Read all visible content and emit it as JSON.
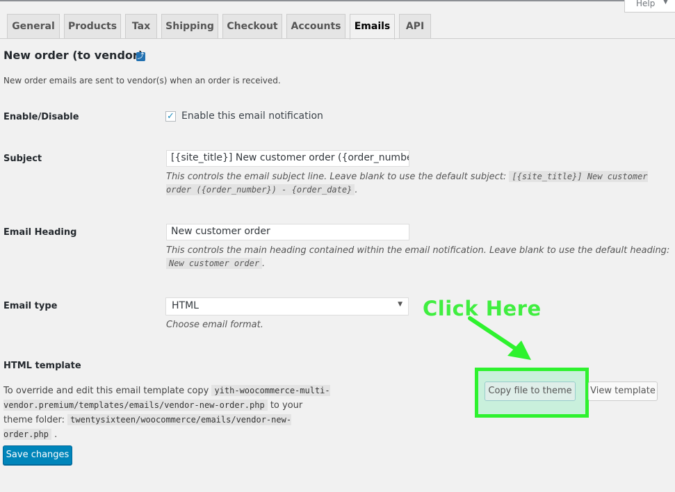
{
  "help": {
    "label": "Help"
  },
  "tabs": [
    {
      "label": "General"
    },
    {
      "label": "Products"
    },
    {
      "label": "Tax"
    },
    {
      "label": "Shipping"
    },
    {
      "label": "Checkout"
    },
    {
      "label": "Accounts"
    },
    {
      "label": "Emails",
      "active": true
    },
    {
      "label": "API"
    }
  ],
  "page": {
    "title": "New order (to vendor)",
    "intro": "New order emails are sent to vendor(s) when an order is received."
  },
  "enable": {
    "label": "Enable/Disable",
    "checkbox_label": "Enable this email notification",
    "checked": true
  },
  "subject": {
    "label": "Subject",
    "value": "[{site_title}] New customer order ({order_number}) - {",
    "desc_prefix": "This controls the email subject line. Leave blank to use the default subject:",
    "desc_code": "[{site_title}] New customer order ({order_number}) - {order_date}",
    "desc_suffix": "."
  },
  "heading": {
    "label": "Email Heading",
    "value": "New customer order",
    "desc_prefix": "This controls the main heading contained within the email notification. Leave blank to use the default heading:",
    "desc_code": "New customer order",
    "desc_suffix": "."
  },
  "email_type": {
    "label": "Email type",
    "selected": "HTML",
    "desc": "Choose email format."
  },
  "html_template": {
    "title": "HTML template",
    "prefix": "To override and edit this email template copy",
    "code1": "yith-woocommerce-multi-vendor.premium/templates/emails/vendor-new-order.php",
    "middle": "to your theme folder:",
    "code2": "twentysixteen/woocommerce/emails/vendor-new-order.php",
    "suffix": ".",
    "copy_button": "Copy file to theme",
    "view_button": "View template"
  },
  "annotation": {
    "text": "Click Here",
    "color": "#40ee40"
  },
  "save_button": "Save changes",
  "colors": {
    "accent": "#0085ba",
    "highlight": "#2ef22e"
  }
}
